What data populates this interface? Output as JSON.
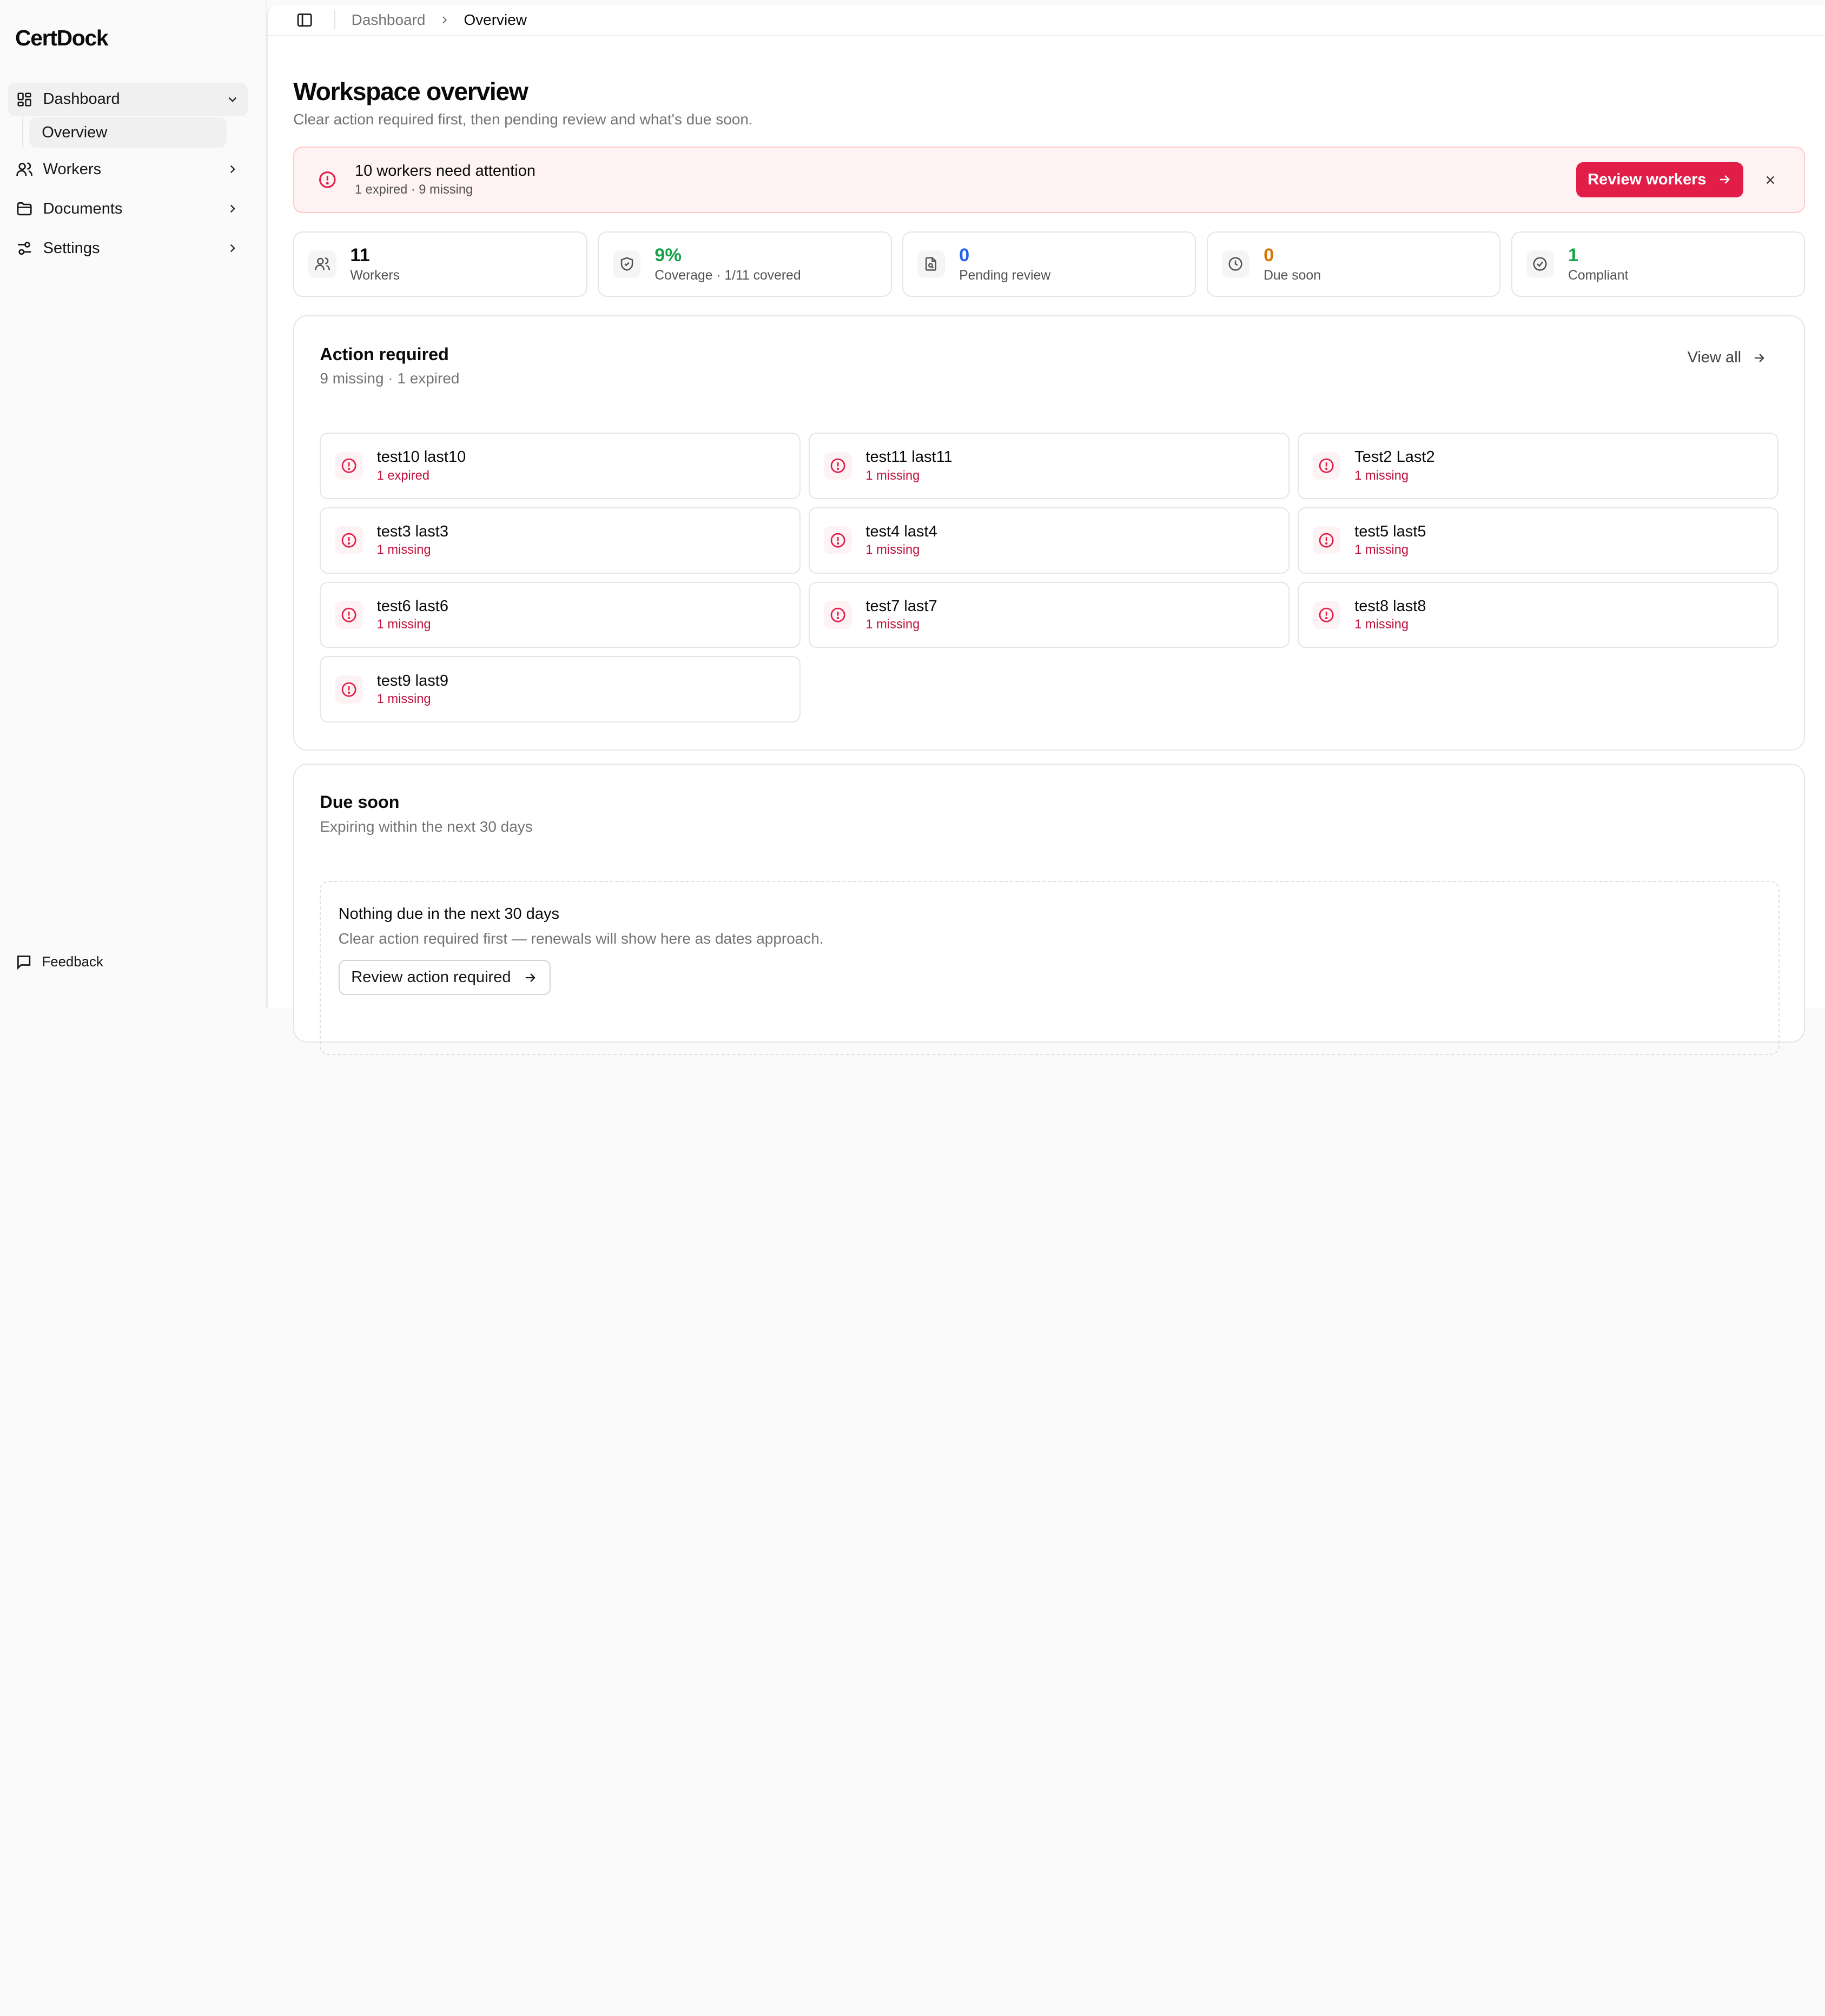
{
  "sidebar": {
    "brand": "CertDock",
    "items": [
      {
        "label": "Dashboard",
        "icon": "dashboard-icon"
      },
      {
        "label": "Workers",
        "icon": "users-icon"
      },
      {
        "label": "Documents",
        "icon": "folder-icon"
      },
      {
        "label": "Settings",
        "icon": "sliders-icon"
      }
    ],
    "sub_items": [
      {
        "label": "Overview"
      }
    ],
    "feedback_label": "Feedback"
  },
  "topbar": {
    "breadcrumb": [
      "Dashboard",
      "Overview"
    ]
  },
  "page": {
    "title": "Workspace overview",
    "subtitle": "Clear action required first, then pending review and what's due soon."
  },
  "alert": {
    "title": "10 workers need attention",
    "subtitle": "1 expired · 9 missing",
    "button_label": "Review workers",
    "accent_color": "#e11d48"
  },
  "stats": [
    {
      "value": "11",
      "label": "Workers",
      "icon": "users-icon",
      "color": "#0a0a0a"
    },
    {
      "value": "9%",
      "label": "Coverage · 1/11 covered",
      "icon": "shield-icon",
      "color": "#16a34a"
    },
    {
      "value": "0",
      "label": "Pending review",
      "icon": "file-search-icon",
      "color": "#2563eb"
    },
    {
      "value": "0",
      "label": "Due soon",
      "icon": "clock-icon",
      "color": "#d97706"
    },
    {
      "value": "1",
      "label": "Compliant",
      "icon": "check-circle-icon",
      "color": "#16a34a"
    }
  ],
  "action_required": {
    "title": "Action required",
    "subtitle": "9 missing · 1 expired",
    "view_all_label": "View all",
    "workers": [
      {
        "name": "test10 last10",
        "status": "1 expired"
      },
      {
        "name": "test11 last11",
        "status": "1 missing"
      },
      {
        "name": "Test2 Last2",
        "status": "1 missing"
      },
      {
        "name": "test3 last3",
        "status": "1 missing"
      },
      {
        "name": "test4 last4",
        "status": "1 missing"
      },
      {
        "name": "test5 last5",
        "status": "1 missing"
      },
      {
        "name": "test6 last6",
        "status": "1 missing"
      },
      {
        "name": "test7 last7",
        "status": "1 missing"
      },
      {
        "name": "test8 last8",
        "status": "1 missing"
      },
      {
        "name": "test9 last9",
        "status": "1 missing"
      }
    ]
  },
  "due_soon": {
    "title": "Due soon",
    "subtitle": "Expiring within the next 30 days",
    "empty_title": "Nothing due in the next 30 days",
    "empty_subtitle": "Clear action required first — renewals will show here as dates approach.",
    "button_label": "Review action required"
  }
}
